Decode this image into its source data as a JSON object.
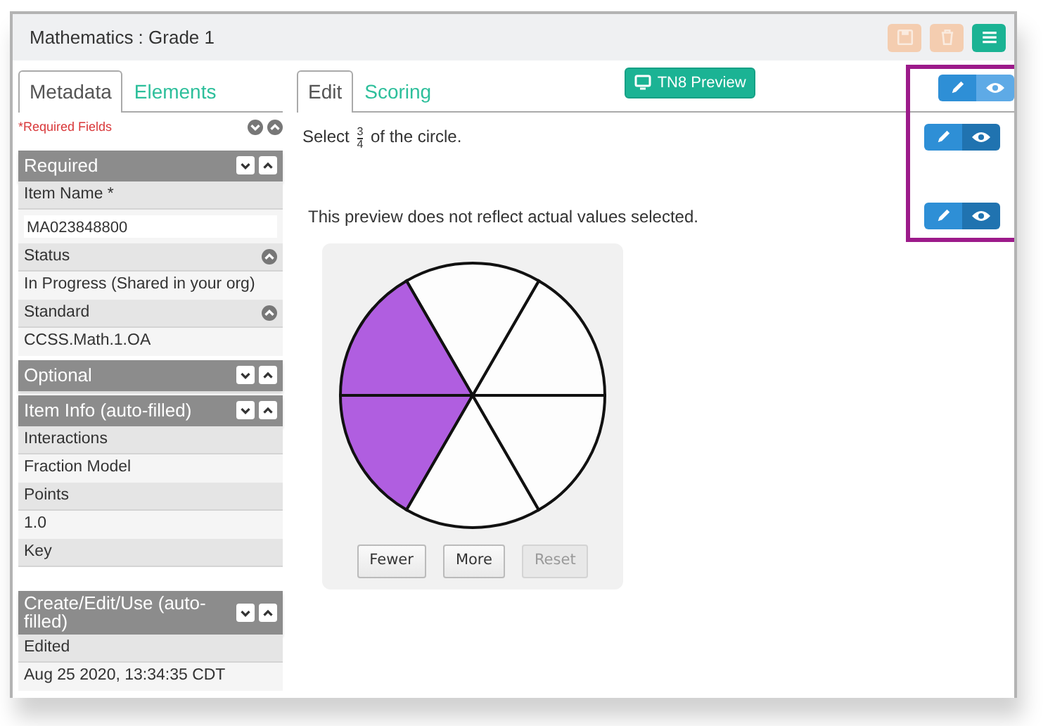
{
  "window": {
    "title": "Mathematics : Grade 1"
  },
  "toolbar": [
    {
      "kind": "save",
      "disabled": true
    },
    {
      "kind": "delete",
      "disabled": true
    },
    {
      "kind": "menu",
      "disabled": false
    }
  ],
  "left_tabs": [
    {
      "label": "Metadata",
      "selected": true
    },
    {
      "label": "Elements",
      "selected": false
    }
  ],
  "required_note": "*Required Fields",
  "sections": [
    {
      "title": "Required",
      "fields": [
        {
          "label": "Item Name *",
          "kind": "input",
          "value": "MA023848800"
        },
        {
          "label": "Status",
          "kind": "text",
          "value": "In Progress (Shared in your org)",
          "expanded": true
        },
        {
          "label": "Standard",
          "kind": "text",
          "value": "CCSS.Math.1.OA",
          "expanded": true
        }
      ]
    },
    {
      "title": "Optional"
    },
    {
      "title": "Item Info (auto-filled)",
      "fields": [
        {
          "label": "Interactions",
          "kind": "text",
          "value": "Fraction Model"
        },
        {
          "label": "Points",
          "kind": "text",
          "value": "1.0"
        },
        {
          "label": "Key",
          "kind": "text"
        }
      ]
    },
    {
      "title": "Create/Edit/Use (auto-filled)",
      "fields": [
        {
          "label": "Edited",
          "kind": "text",
          "value": "Aug 25 2020, 13:34:35 CDT"
        }
      ]
    }
  ],
  "right_tabs": [
    {
      "label": "Edit",
      "selected": true
    },
    {
      "label": "Scoring",
      "selected": false
    }
  ],
  "preview_button": "TN8 Preview",
  "view_toggles": [
    {
      "preview_active": false
    },
    {
      "preview_active": true
    },
    {
      "preview_active": true
    }
  ],
  "prompt": {
    "before": "Select",
    "numerator": "3",
    "denominator": "4",
    "after": "of the circle."
  },
  "notice": "This preview does not reflect actual values selected.",
  "fraction_model": {
    "slices": [
      {
        "selected": false
      },
      {
        "selected": false
      },
      {
        "selected": true
      },
      {
        "selected": true
      },
      {
        "selected": false
      },
      {
        "selected": false
      }
    ],
    "buttons": [
      {
        "label": "Fewer",
        "disabled": false
      },
      {
        "label": "More",
        "disabled": false
      },
      {
        "label": "Reset",
        "disabled": true
      }
    ]
  }
}
